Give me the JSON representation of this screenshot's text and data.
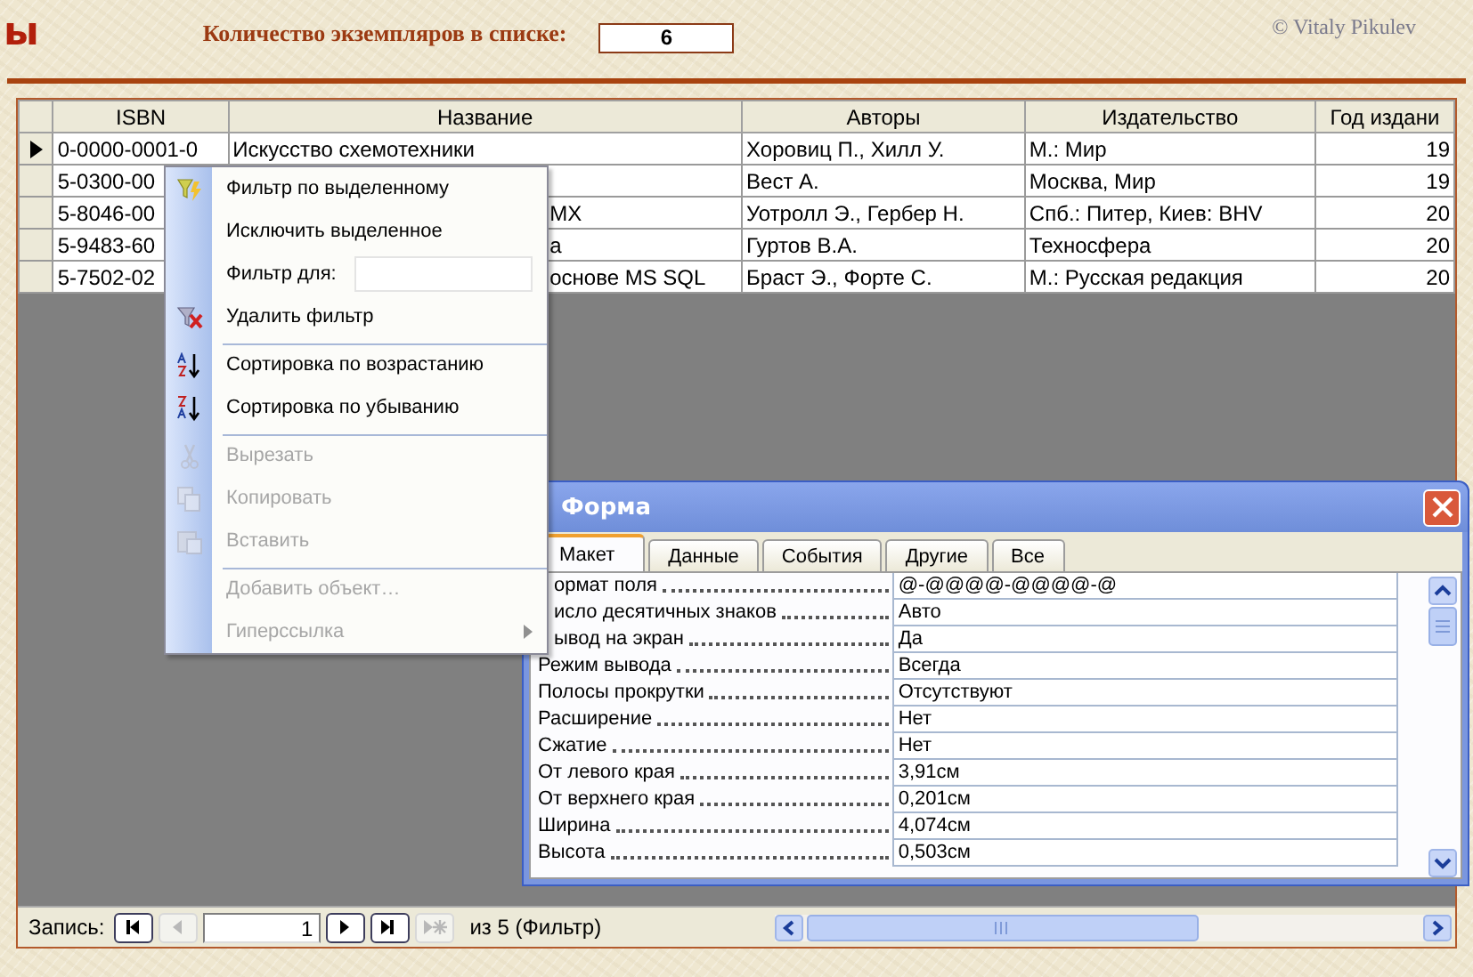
{
  "header": {
    "title": "ы",
    "count_label": "Количество экземпляров в списке:",
    "count_value": "6",
    "copyright": "© Vitaly Pikulev"
  },
  "table": {
    "columns": [
      "ISBN",
      "Название",
      "Авторы",
      "Издательство",
      "Год издани"
    ],
    "rows": [
      {
        "current": true,
        "cells": [
          {
            "text": "0-0000-0001-0",
            "tail": false
          },
          {
            "text": "Искусство схемотехники",
            "tail": false
          },
          {
            "text": "Хоровиц П., Хилл У.",
            "tail": false
          },
          {
            "text": "М.: Мир",
            "tail": false
          },
          {
            "text": "19",
            "tail": false
          }
        ]
      },
      {
        "current": false,
        "cells": [
          {
            "text": "5-0300-00",
            "tail": false
          },
          null,
          {
            "text": "Вест А.",
            "tail": false
          },
          {
            "text": "Москва, Мир",
            "tail": false
          },
          {
            "text": "19",
            "tail": false
          }
        ]
      },
      {
        "current": false,
        "cells": [
          {
            "text": "5-8046-00",
            "tail": false
          },
          {
            "text": "МХ",
            "tail": true
          },
          {
            "text": "Уотролл Э., Гербер Н.",
            "tail": false
          },
          {
            "text": "Спб.: Питер, Киев: BHV",
            "tail": false
          },
          {
            "text": "20",
            "tail": false
          }
        ]
      },
      {
        "current": false,
        "cells": [
          {
            "text": "5-9483-60",
            "tail": false
          },
          {
            "text": "а",
            "tail": true
          },
          {
            "text": "Гуртов В.А.",
            "tail": false
          },
          {
            "text": "Техносфера",
            "tail": false
          },
          {
            "text": "20",
            "tail": false
          }
        ]
      },
      {
        "current": false,
        "cells": [
          {
            "text": "5-7502-02",
            "tail": false
          },
          {
            "text": "основе MS SQL",
            "tail": true
          },
          {
            "text": "Браст Э., Форте С.",
            "tail": false
          },
          {
            "text": "М.: Русская редакция",
            "tail": false
          },
          {
            "text": "20",
            "tail": false
          }
        ]
      }
    ]
  },
  "navigation": {
    "label": "Запись:",
    "record": "1",
    "total": "из 5 (Фильтр)",
    "buttons": [
      {
        "disabled": false
      },
      {
        "disabled": true
      },
      {
        "disabled": false
      },
      {
        "disabled": false
      },
      {
        "disabled": true
      }
    ]
  },
  "context_menu": {
    "items": [
      {
        "kind": "item",
        "label": "Фильтр по выделенному",
        "disabled": false,
        "separator_before": false,
        "submenu": false
      },
      {
        "kind": "item",
        "label": "Исключить выделенное",
        "disabled": false,
        "separator_before": false,
        "submenu": false
      },
      {
        "kind": "field",
        "label": "Фильтр для:",
        "disabled": false,
        "separator_before": false,
        "submenu": false
      },
      {
        "kind": "item",
        "label": "Удалить фильтр",
        "disabled": false,
        "separator_before": false,
        "submenu": false
      },
      {
        "kind": "item",
        "label": "Сортировка по возрастанию",
        "disabled": false,
        "separator_before": true,
        "submenu": false
      },
      {
        "kind": "item",
        "label": "Сортировка по убыванию",
        "disabled": false,
        "separator_before": false,
        "submenu": false
      },
      {
        "kind": "item",
        "label": "Вырезать",
        "disabled": true,
        "separator_before": true,
        "submenu": false
      },
      {
        "kind": "item",
        "label": "Копировать",
        "disabled": true,
        "separator_before": false,
        "submenu": false
      },
      {
        "kind": "item",
        "label": "Вставить",
        "disabled": true,
        "separator_before": false,
        "submenu": false
      },
      {
        "kind": "item",
        "label": "Добавить объект…",
        "disabled": true,
        "separator_before": true,
        "submenu": false
      },
      {
        "kind": "item",
        "label": "Гиперссылка",
        "disabled": true,
        "separator_before": false,
        "submenu": true
      }
    ]
  },
  "property_window": {
    "title": "Форма",
    "tabs": [
      {
        "label": "Макет",
        "selected": true
      },
      {
        "label": "Данные",
        "selected": false
      },
      {
        "label": "События",
        "selected": false
      },
      {
        "label": "Другие",
        "selected": false
      },
      {
        "label": "Все",
        "selected": false
      }
    ],
    "properties": [
      {
        "name": "ормат поля",
        "value": "@-@@@@-@@@@-@",
        "clipped": true
      },
      {
        "name": "исло десятичных знаков",
        "value": "Авто",
        "clipped": true
      },
      {
        "name": "ывод на экран",
        "value": "Да",
        "clipped": true
      },
      {
        "name": "Режим вывода",
        "value": "Всегда",
        "clipped": false
      },
      {
        "name": "Полосы прокрутки",
        "value": "Отсутствуют",
        "clipped": false
      },
      {
        "name": "Расширение",
        "value": "Нет",
        "clipped": false
      },
      {
        "name": "Сжатие",
        "value": "Нет",
        "clipped": false
      },
      {
        "name": "От левого края",
        "value": "3,91см",
        "clipped": false
      },
      {
        "name": "От верхнего края",
        "value": "0,201см",
        "clipped": false
      },
      {
        "name": "Ширина",
        "value": "4,074см",
        "clipped": false
      },
      {
        "name": "Высота",
        "value": "0,503см",
        "clipped": false
      }
    ]
  }
}
